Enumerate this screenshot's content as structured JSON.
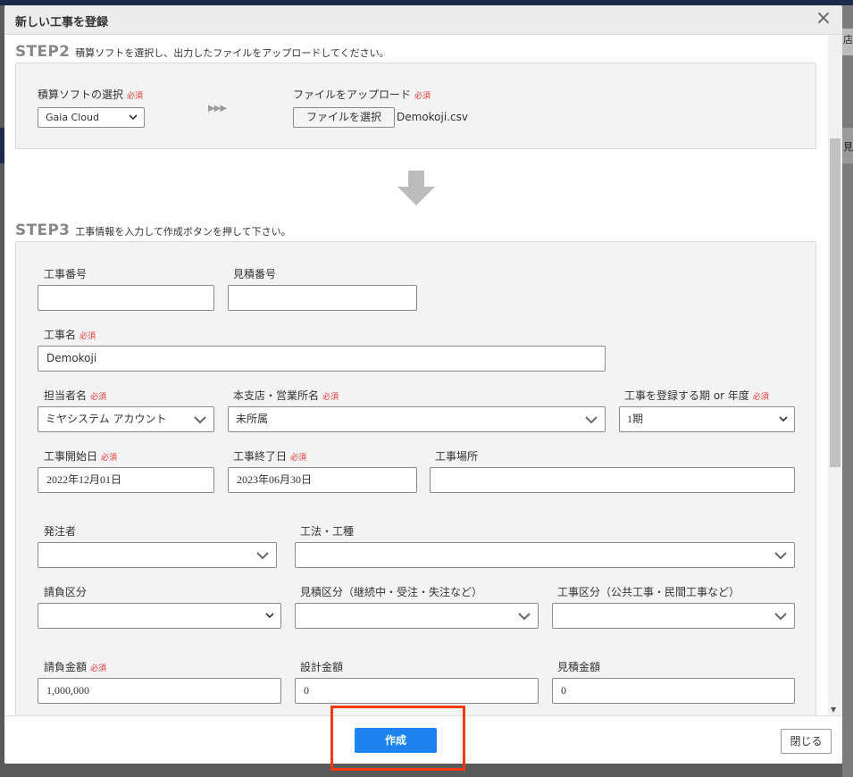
{
  "background": {
    "right_text_1": "店",
    "right_text_2": "見"
  },
  "modal": {
    "title": "新しい工事を登録"
  },
  "step2": {
    "label": "STEP2",
    "description": "積算ソフトを選択し、出力したファイルをアップロードしてください。",
    "software_label": "積算ソフトの選択",
    "software_value": "Gaia Cloud",
    "file_label": "ファイルをアップロード",
    "file_button": "ファイルを選択",
    "file_name": "Demokoji.csv",
    "arrows": "▶▶▶"
  },
  "step3": {
    "label": "STEP3",
    "description": "工事情報を入力して作成ボタンを押して下さい。"
  },
  "required_text": "必須",
  "form": {
    "koji_bango_label": "工事番号",
    "koji_bango_value": "",
    "mitsumori_bango_label": "見積番号",
    "mitsumori_bango_value": "",
    "koji_mei_label": "工事名",
    "koji_mei_value": "Demokoji",
    "tanto_label": "担当者名",
    "tanto_value": "ミヤシステム アカウント",
    "shiten_label": "本支店・営業所名",
    "shiten_value": "未所属",
    "kikan_label": "工事を登録する期 or 年度",
    "kikan_value": "1期",
    "start_label": "工事開始日",
    "start_value": "2022年12月01日",
    "end_label": "工事終了日",
    "end_value": "2023年06月30日",
    "basho_label": "工事場所",
    "basho_value": "",
    "hacchusha_label": "発注者",
    "hacchusha_value": "",
    "koho_label": "工法・工種",
    "koho_value": "",
    "ukeoi_kubun_label": "請負区分",
    "ukeoi_kubun_value": "",
    "mitsumori_kubun_label": "見積区分（継続中・受注・失注など）",
    "mitsumori_kubun_value": "",
    "koji_kubun_label": "工事区分（公共工事・民間工事など）",
    "koji_kubun_value": "",
    "ukeoi_kingaku_label": "請負金額",
    "ukeoi_kingaku_value": "1,000,000",
    "sekkei_kingaku_label": "設計金額",
    "sekkei_kingaku_value": "0",
    "mitsumori_kingaku_label": "見積金額",
    "mitsumori_kingaku_value": "0"
  },
  "footer": {
    "create_label": "作成",
    "close_label": "閉じる"
  },
  "colors": {
    "primary": "#1c83f0",
    "required": "#e53935",
    "highlight": "#f23a0f"
  }
}
